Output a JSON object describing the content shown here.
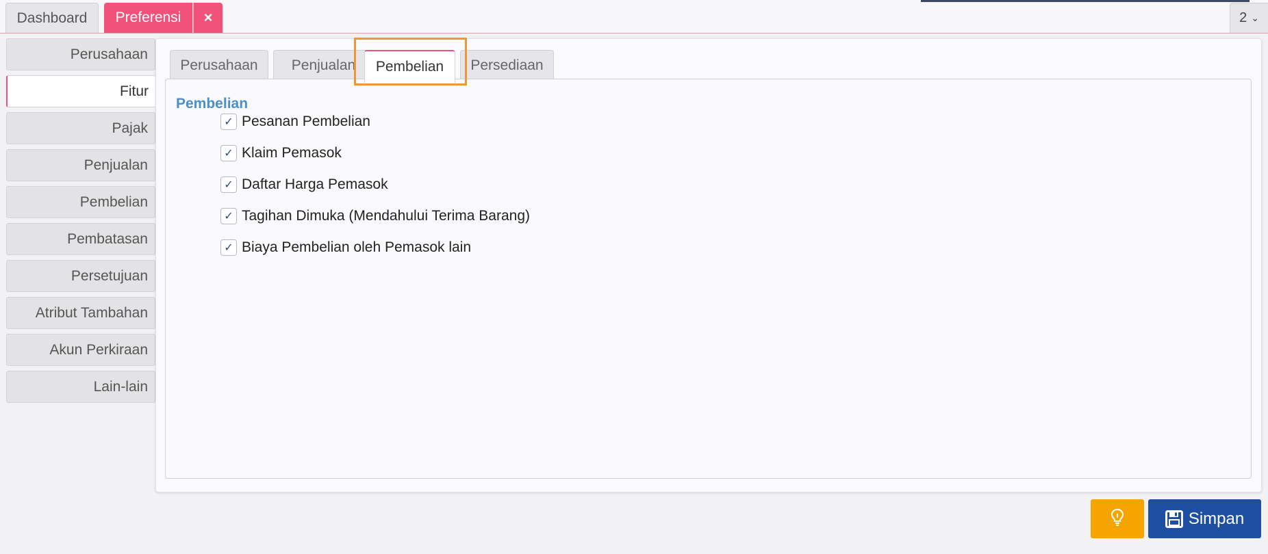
{
  "top_tabs": {
    "dashboard": "Dashboard",
    "preferensi": "Preferensi",
    "close_icon": "×",
    "counter": "2"
  },
  "sidebar": {
    "items": [
      {
        "label": "Perusahaan",
        "active": false
      },
      {
        "label": "Fitur",
        "active": true
      },
      {
        "label": "Pajak",
        "active": false
      },
      {
        "label": "Penjualan",
        "active": false
      },
      {
        "label": "Pembelian",
        "active": false
      },
      {
        "label": "Pembatasan",
        "active": false
      },
      {
        "label": "Persetujuan",
        "active": false
      },
      {
        "label": "Atribut Tambahan",
        "active": false
      },
      {
        "label": "Akun Perkiraan",
        "active": false
      },
      {
        "label": "Lain-lain",
        "active": false
      }
    ]
  },
  "subtabs": [
    {
      "label": "Perusahaan",
      "active": false
    },
    {
      "label": "Penjualan",
      "active": false
    },
    {
      "label": "Pembelian",
      "active": true
    },
    {
      "label": "Persediaan",
      "active": false
    }
  ],
  "section": {
    "title": "Pembelian",
    "options": [
      {
        "label": "Pesanan Pembelian",
        "checked": true
      },
      {
        "label": "Klaim Pemasok",
        "checked": true
      },
      {
        "label": "Daftar Harga Pemasok",
        "checked": true
      },
      {
        "label": "Tagihan Dimuka (Mendahului Terima Barang)",
        "checked": true
      },
      {
        "label": "Biaya Pembelian oleh Pemasok lain",
        "checked": true
      }
    ]
  },
  "buttons": {
    "hint_icon": "lightbulb-icon",
    "save_label": "Simpan"
  },
  "colors": {
    "accent_pink": "#f2527a",
    "highlight_orange": "#f0963a",
    "save_blue": "#1f4fa3",
    "hint_amber": "#f7a400",
    "section_title_blue": "#4a8fc8"
  }
}
